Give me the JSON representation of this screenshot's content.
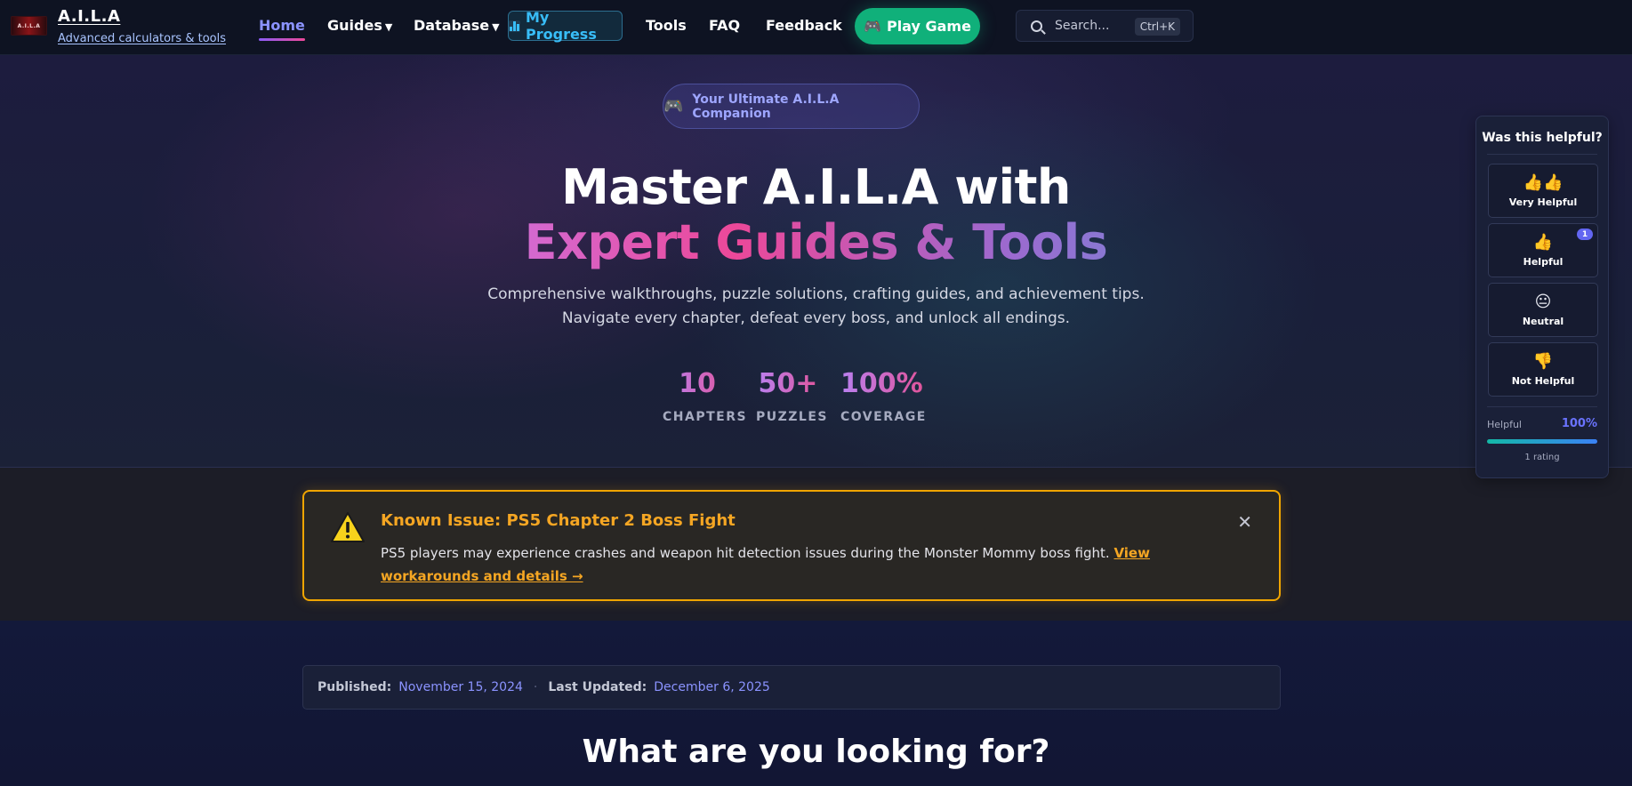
{
  "brand": {
    "logo_text": "A.I.L.A",
    "name": "A.I.L.A",
    "tagline": "Advanced calculators & tools"
  },
  "nav": {
    "home": "Home",
    "guides": "Guides",
    "database": "Database",
    "progress": "My Progress",
    "tools": "Tools",
    "faq": "FAQ",
    "feedback": "Feedback",
    "play": "Play Game",
    "caret": "▼"
  },
  "search": {
    "placeholder": "Search...",
    "shortcut": "Ctrl+K"
  },
  "hero": {
    "pill_icon": "🎮",
    "pill": "Your Ultimate A.I.L.A Companion",
    "title_line1": "Master A.I.L.A with",
    "title_line2": "Expert Guides & Tools",
    "subtitle_line1": "Comprehensive walkthroughs, puzzle solutions, crafting guides, and achievement tips.",
    "subtitle_line2": "Navigate every chapter, defeat every boss, and unlock all endings.",
    "stats": [
      {
        "value": "10",
        "label": "CHAPTERS"
      },
      {
        "value": "50+",
        "label": "PUZZLES"
      },
      {
        "value": "100%",
        "label": "COVERAGE"
      }
    ]
  },
  "alert": {
    "title": "Known Issue: PS5 Chapter 2 Boss Fight",
    "text": "PS5 players may experience crashes and weapon hit detection issues during the Monster Mommy boss fight.",
    "link": "View workarounds and details →",
    "close": "✕"
  },
  "meta": {
    "published_label": "Published:",
    "published": "November 15, 2024",
    "separator": "·",
    "updated_label": "Last Updated:",
    "updated": "December 6, 2025"
  },
  "section": {
    "title": "What are you looking for?"
  },
  "feedback_widget": {
    "title": "Was this helpful?",
    "options": [
      {
        "emoji": "👍👍",
        "label": "Very Helpful"
      },
      {
        "emoji": "👍",
        "label": "Helpful",
        "badge": "1"
      },
      {
        "emoji": "😐",
        "label": "Neutral"
      },
      {
        "emoji": "👎",
        "label": "Not Helpful"
      }
    ],
    "stat_label": "Helpful",
    "stat_value": "100%",
    "helpful_fraction": 1.0,
    "count": "1 rating"
  },
  "colors": {
    "accent": "#8b93ff",
    "play": "#10b07a",
    "warning": "#f5a623"
  }
}
